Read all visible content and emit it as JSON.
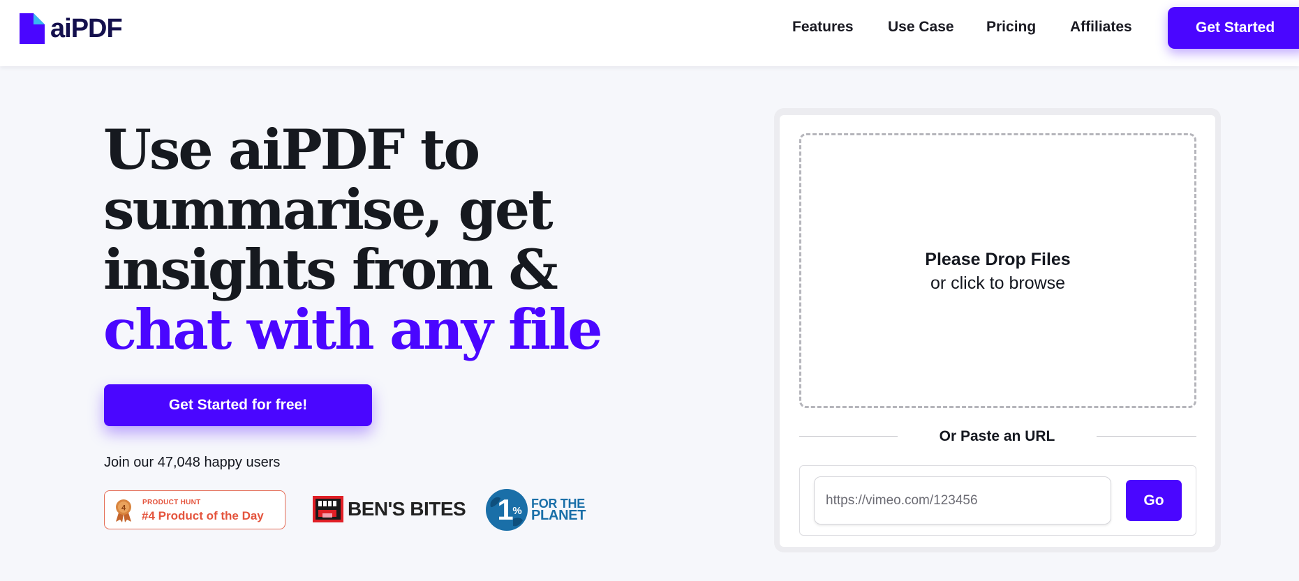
{
  "header": {
    "logo_text": "aiPDF",
    "logo_icon": "document-icon",
    "nav": [
      {
        "label": "Features"
      },
      {
        "label": "Use Case"
      },
      {
        "label": "Pricing"
      },
      {
        "label": "Affiliates"
      }
    ],
    "cta_label": "Get Started"
  },
  "hero": {
    "title_lines": [
      "Use aiPDF to",
      "summarise, get",
      "insights from &"
    ],
    "title_accent": "chat with any file",
    "cta_label": "Get Started for free!",
    "join_text": "Join our 47,048 happy users"
  },
  "badges": {
    "producthunt": {
      "small": "PRODUCT HUNT",
      "big": "#4 Product of the Day",
      "medal_number": "4"
    },
    "bens_bites": {
      "text": "BEN'S BITES"
    },
    "one_percent": {
      "number": "1",
      "line1": "FOR THE",
      "line2": "PLANET"
    }
  },
  "upload": {
    "drop_title": "Please Drop Files",
    "drop_sub": "or click to browse",
    "paste_label": "Or Paste an URL",
    "url_placeholder": "https://vimeo.com/123456",
    "go_label": "Go"
  },
  "colors": {
    "accent": "#4a06ff",
    "logo_dark": "#14104d",
    "producthunt": "#e4543d",
    "planet_blue": "#1a6fa8"
  }
}
